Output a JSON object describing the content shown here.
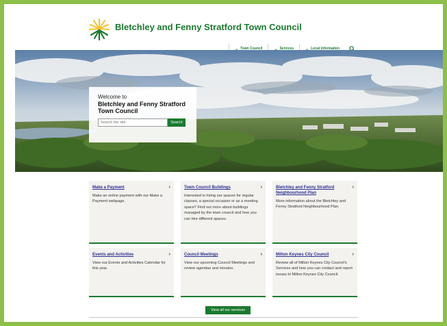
{
  "header": {
    "site_name": "Bletchley and Fenny Stratford Town Council",
    "nav": [
      {
        "label": "Town Council"
      },
      {
        "label": "Services"
      },
      {
        "label": "Local Information"
      }
    ],
    "search_icon": "search-icon"
  },
  "hero": {
    "welcome_pre": "Welcome to",
    "welcome_title": "Bletchley and Fenny Stratford Town Council",
    "search_placeholder": "Search the site",
    "search_button": "Search"
  },
  "cards": [
    {
      "title": "Make a Payment",
      "desc": "Make an online payment with our Make a Payment webpage."
    },
    {
      "title": "Town Council Buildings",
      "desc": "Interested in hiring our spaces for regular classes, a special occasion or as a meeting space? Find out more about buildings managed by the town council and how you can hire different spaces."
    },
    {
      "title": "Bletchley and Fenny Stratford Neighbourhood Plan",
      "desc": "More information about the Bletchley and Fenny Stratford Neighbourhood Plan."
    },
    {
      "title": "Events and Activities",
      "desc": "View our Events and Activities Calendar for this year."
    },
    {
      "title": "Council Meetings",
      "desc": "View our upcoming Council Meetings and review agendas and minutes."
    },
    {
      "title": "Milton Keynes City Council",
      "desc": "Review all of Milton Keynes City Council's Services and how you can contact and report issues to Milton Keynes City Council."
    }
  ],
  "view_all": "View all our services",
  "colors": {
    "brand_green": "#1a7a2e",
    "link_blue": "#2b2f8f",
    "accent_yellow": "#f3e45c",
    "frame_green": "#8dbf4a"
  }
}
